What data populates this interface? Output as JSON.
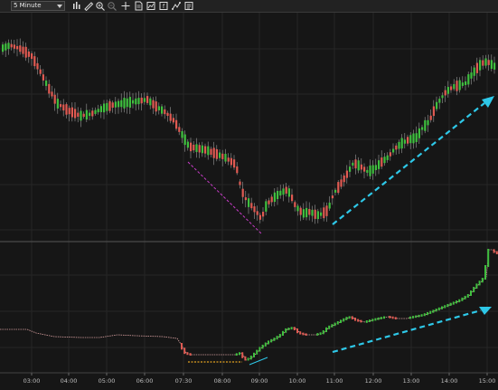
{
  "toolbar": {
    "timeframe": "5 Minute",
    "icons": [
      "bar-chart-icon",
      "pencil-draw-icon",
      "zoom-in-icon",
      "zoom-out-icon",
      "crosshair-icon",
      "data-box-icon",
      "chart-style-icon",
      "indicators-icon",
      "strategies-icon",
      "properties-icon"
    ]
  },
  "colors": {
    "background": "#161616",
    "grid": "#262626",
    "up_candle": "#3fbf3f",
    "down_candle": "#e05a52",
    "wick": "#9a9a9a",
    "indicator_line": "#d8a0a0",
    "arrow": "#2ec8e8",
    "divergence_price": "#c83cc8",
    "divergence_indicator": "#e0a020"
  },
  "x_axis": {
    "labels": [
      "03:00",
      "04:00",
      "05:00",
      "06:00",
      "07:30",
      "08:00",
      "09:00",
      "10:00",
      "11:00",
      "12:00",
      "13:00",
      "14:00",
      "15:00"
    ]
  },
  "annotations": [
    {
      "name": "price-uptrend-arrow",
      "color": "cyan",
      "style": "dashed"
    },
    {
      "name": "indicator-uptrend-arrow",
      "color": "cyan",
      "style": "dashed"
    },
    {
      "name": "price-downtrend-line",
      "color": "magenta",
      "style": "dashed"
    },
    {
      "name": "indicator-flat-line",
      "color": "orange",
      "style": "dashed"
    },
    {
      "name": "indicator-divergence-line",
      "color": "cyan",
      "style": "solid"
    }
  ]
}
